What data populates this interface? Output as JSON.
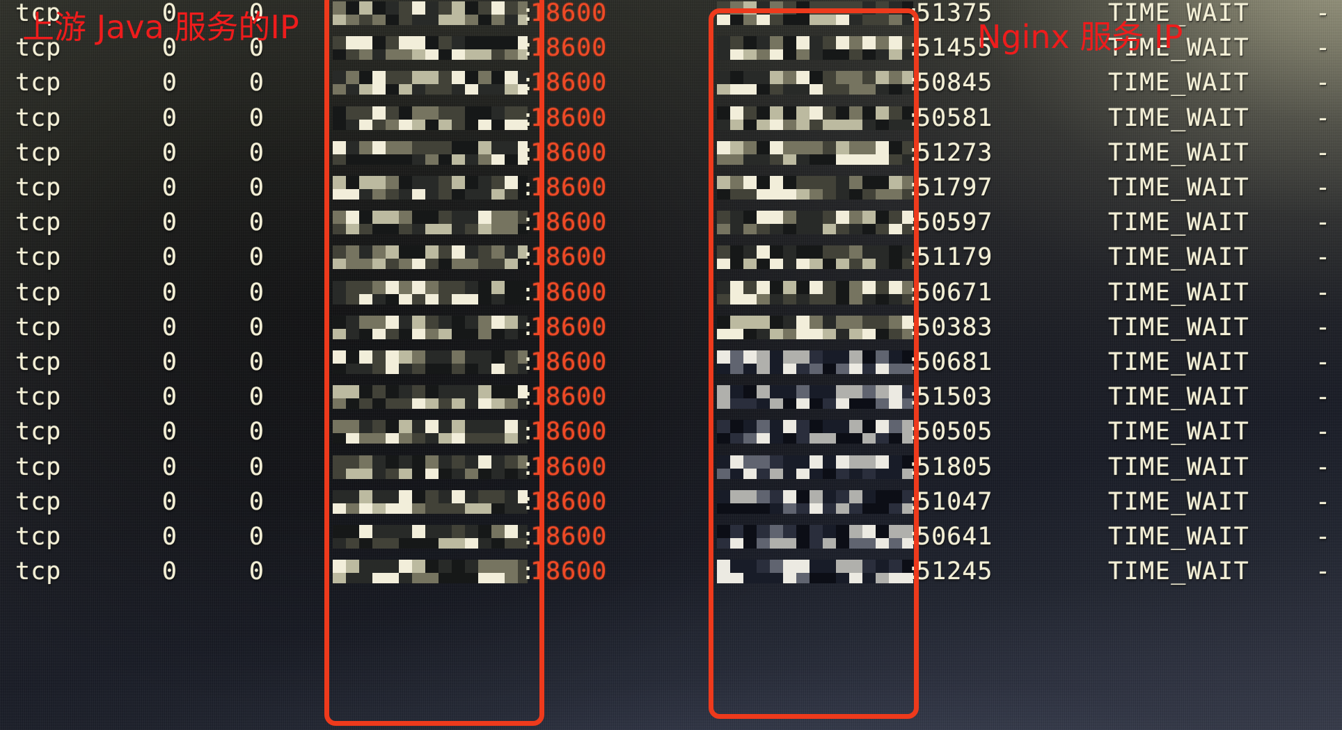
{
  "capture": {
    "kind": "photo-of-monitor",
    "command_output": "netstat",
    "theme": {
      "text_color": "#f3efd6",
      "local_port_color": "#ef4a26",
      "annotation_color": "#ee1c1c",
      "highlight_box_color": "#ee3a1c",
      "background_top_right": "#7a7a6b",
      "background_center": "#1b1d24",
      "background_bottom": "#464a58"
    }
  },
  "annotations": [
    {
      "id": "upstream-java-ip",
      "text": "上游 Java 服务的IP",
      "color": "#ee1c1c",
      "points_at": "local-address-column"
    },
    {
      "id": "nginx-service-ip",
      "text": "Nginx 服务 IP",
      "color": "#ee1c1c",
      "points_at": "foreign-address-column"
    }
  ],
  "highlight_boxes": [
    {
      "id": "local-address-box",
      "label": "上游 Java 服务的IP",
      "color": "#ee3a1c"
    },
    {
      "id": "foreign-address-box",
      "label": "Nginx 服务 IP",
      "color": "#ee3a1c"
    }
  ],
  "table": {
    "columns": [
      "proto",
      "recv_q",
      "send_q",
      "local_address",
      "foreign_address",
      "state",
      "pid_program"
    ],
    "local_address_redacted": true,
    "foreign_address_redacted": true,
    "local_port_shared": "18600",
    "rows": [
      {
        "proto": "tcp",
        "recv_q": "0",
        "send_q": "0",
        "local_ip": "redacted",
        "local_port": "18600",
        "foreign_ip": "redacted",
        "foreign_port": "51375",
        "state": "TIME_WAIT",
        "pid_program": "-"
      },
      {
        "proto": "tcp",
        "recv_q": "0",
        "send_q": "0",
        "local_ip": "redacted",
        "local_port": "18600",
        "foreign_ip": "redacted",
        "foreign_port": "51455",
        "state": "TIME_WAIT",
        "pid_program": "-"
      },
      {
        "proto": "tcp",
        "recv_q": "0",
        "send_q": "0",
        "local_ip": "redacted",
        "local_port": "18600",
        "foreign_ip": "redacted",
        "foreign_port": "50845",
        "state": "TIME_WAIT",
        "pid_program": "-"
      },
      {
        "proto": "tcp",
        "recv_q": "0",
        "send_q": "0",
        "local_ip": "redacted",
        "local_port": "18600",
        "foreign_ip": "redacted",
        "foreign_port": "50581",
        "state": "TIME_WAIT",
        "pid_program": "-"
      },
      {
        "proto": "tcp",
        "recv_q": "0",
        "send_q": "0",
        "local_ip": "redacted",
        "local_port": "18600",
        "foreign_ip": "redacted",
        "foreign_port": "51273",
        "state": "TIME_WAIT",
        "pid_program": "-"
      },
      {
        "proto": "tcp",
        "recv_q": "0",
        "send_q": "0",
        "local_ip": "redacted",
        "local_port": "18600",
        "foreign_ip": "redacted",
        "foreign_port": "51797",
        "state": "TIME_WAIT",
        "pid_program": "-"
      },
      {
        "proto": "tcp",
        "recv_q": "0",
        "send_q": "0",
        "local_ip": "redacted",
        "local_port": "18600",
        "foreign_ip": "redacted",
        "foreign_port": "50597",
        "state": "TIME_WAIT",
        "pid_program": "-"
      },
      {
        "proto": "tcp",
        "recv_q": "0",
        "send_q": "0",
        "local_ip": "redacted",
        "local_port": "18600",
        "foreign_ip": "redacted",
        "foreign_port": "51179",
        "state": "TIME_WAIT",
        "pid_program": "-"
      },
      {
        "proto": "tcp",
        "recv_q": "0",
        "send_q": "0",
        "local_ip": "redacted",
        "local_port": "18600",
        "foreign_ip": "redacted",
        "foreign_port": "50671",
        "state": "TIME_WAIT",
        "pid_program": "-"
      },
      {
        "proto": "tcp",
        "recv_q": "0",
        "send_q": "0",
        "local_ip": "redacted",
        "local_port": "18600",
        "foreign_ip": "redacted",
        "foreign_port": "50383",
        "state": "TIME_WAIT",
        "pid_program": "-"
      },
      {
        "proto": "tcp",
        "recv_q": "0",
        "send_q": "0",
        "local_ip": "redacted",
        "local_port": "18600",
        "foreign_ip": "redacted",
        "foreign_port": "50681",
        "state": "TIME_WAIT",
        "pid_program": "-"
      },
      {
        "proto": "tcp",
        "recv_q": "0",
        "send_q": "0",
        "local_ip": "redacted",
        "local_port": "18600",
        "foreign_ip": "redacted",
        "foreign_port": "51503",
        "state": "TIME_WAIT",
        "pid_program": "-"
      },
      {
        "proto": "tcp",
        "recv_q": "0",
        "send_q": "0",
        "local_ip": "redacted",
        "local_port": "18600",
        "foreign_ip": "redacted",
        "foreign_port": "50505",
        "state": "TIME_WAIT",
        "pid_program": "-"
      },
      {
        "proto": "tcp",
        "recv_q": "0",
        "send_q": "0",
        "local_ip": "redacted",
        "local_port": "18600",
        "foreign_ip": "redacted",
        "foreign_port": "51805",
        "state": "TIME_WAIT",
        "pid_program": "-"
      },
      {
        "proto": "tcp",
        "recv_q": "0",
        "send_q": "0",
        "local_ip": "redacted",
        "local_port": "18600",
        "foreign_ip": "redacted",
        "foreign_port": "51047",
        "state": "TIME_WAIT",
        "pid_program": "-"
      },
      {
        "proto": "tcp",
        "recv_q": "0",
        "send_q": "0",
        "local_ip": "redacted",
        "local_port": "18600",
        "foreign_ip": "redacted",
        "foreign_port": "50641",
        "state": "TIME_WAIT",
        "pid_program": "-"
      },
      {
        "proto": "tcp",
        "recv_q": "0",
        "send_q": "0",
        "local_ip": "redacted",
        "local_port": "18600",
        "foreign_ip": "redacted",
        "foreign_port": "51245",
        "state": "TIME_WAIT",
        "pid_program": "-"
      }
    ]
  }
}
